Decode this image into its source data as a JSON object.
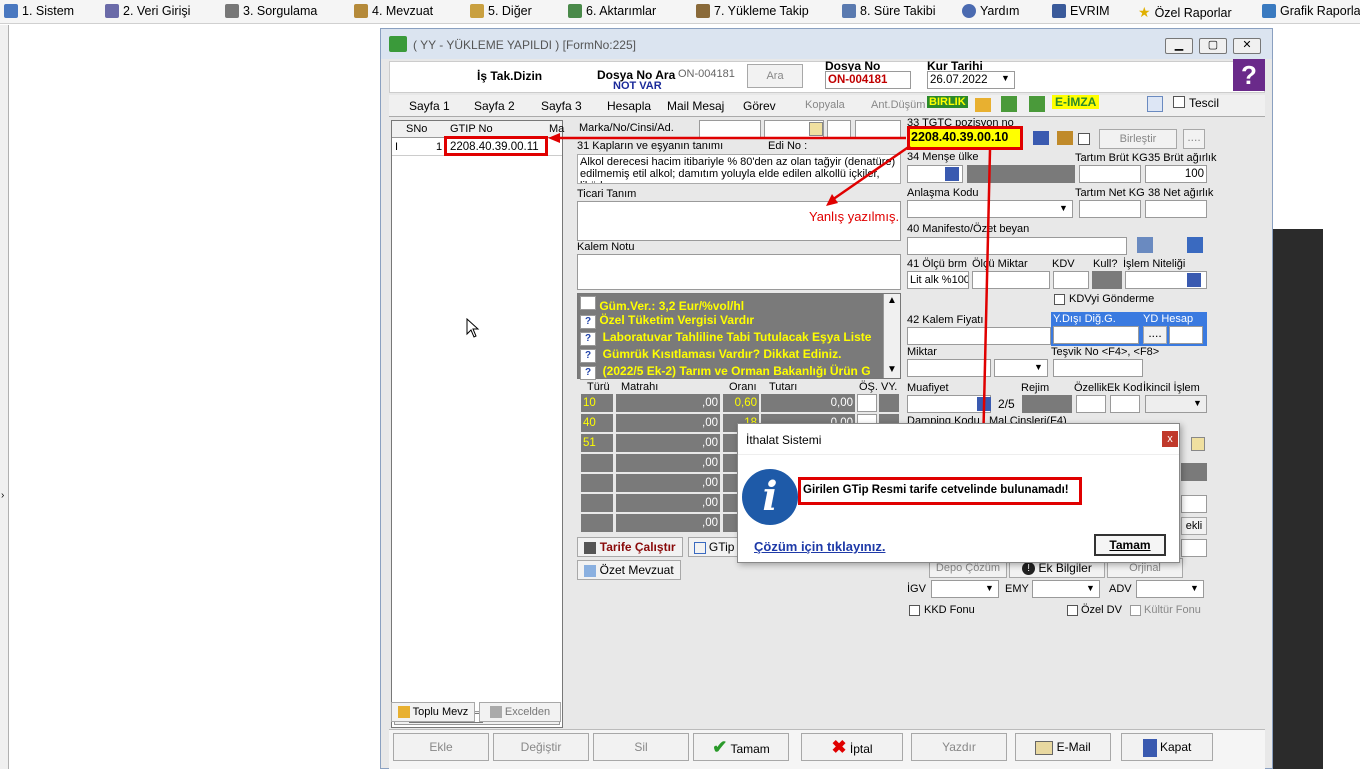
{
  "menu": [
    {
      "label": "1.  Sistem",
      "icon": "person-icon"
    },
    {
      "label": "2.  Veri Girişi",
      "icon": "edit-icon"
    },
    {
      "label": "3.  Sorgulama",
      "icon": "search-icon"
    },
    {
      "label": "4.  Mevzuat",
      "icon": "books-icon"
    },
    {
      "label": "5.  Diğer",
      "icon": "tools-icon"
    },
    {
      "label": "6.  Aktarımlar",
      "icon": "gear-icon"
    },
    {
      "label": "7.  Yükleme Takip",
      "icon": "pencil-icon"
    },
    {
      "label": "8. Süre Takibi",
      "icon": "calendar-icon"
    },
    {
      "label": "Yardım",
      "icon": "help-icon"
    },
    {
      "label": "EVRIM",
      "icon": "evrim-icon"
    },
    {
      "label": "Özel Raporlar",
      "icon": "star-icon"
    },
    {
      "label": "Grafik Raporlar",
      "icon": "chart-icon"
    }
  ],
  "window": {
    "title": "( YY  - YÜKLEME YAPILDI ) [FormNo:225]"
  },
  "header": {
    "is_takip": "İş Tak.Dizin",
    "dosya_no_ara": "Dosya No Ara",
    "dosya_no_ara_value": "ON-004181",
    "not_var": "NOT VAR",
    "ara": "Ara",
    "dosya_no_label": "Dosya No",
    "dosya_no_value": "ON-004181",
    "kur_tarihi_label": "Kur Tarihi",
    "kur_tarihi_value": "26.07.2022"
  },
  "tabs": [
    "Sayfa 1",
    "Sayfa 2",
    "Sayfa 3",
    "Hesapla",
    "Mail Mesaj",
    "Görev",
    "Kopyala",
    "Ant.Düşüm"
  ],
  "toolbar": {
    "birlik": "BIRLIK",
    "eimza": "E-İMZA",
    "tescil": "Tescil"
  },
  "grid": {
    "headers": [
      "SNo",
      "GTIP No",
      "Ma"
    ],
    "row": {
      "marker": "I",
      "sno": "1",
      "gtip": "2208.40.39.00.11"
    }
  },
  "item": {
    "marka_label": "Marka/No/Cinsi/Ad.",
    "kap_label": "31 Kapların ve eşyanın tanımı",
    "edi_label": "Edi No :",
    "description": "Alkol derecesi hacim itibariyle % 80'den az olan tağyir (denatüre) edilmemiş etil alkol; damıtım yoluyla elde edilen alkollü içkiler, likörler",
    "ticari_label": "Ticari Tanım",
    "kalem_notu_label": "Kalem Notu",
    "annotation": "Yanlış yazılmış.",
    "warnings": [
      "Güm.Ver.: 3,2 Eur/%vol/hl",
      "Özel Tüketim Vergisi Vardır",
      "Laboratuvar Tahliline Tabi Tutulacak Eşya Liste",
      "Gümrük Kısıtlaması Vardır? Dikkat Ediniz.",
      "(2022/5 Ek-2) Tarım ve Orman Bakanlığı Ürün G"
    ]
  },
  "tax": {
    "headers": [
      "Türü",
      "Matrahı",
      "Oranı",
      "Tutarı",
      "ÖŞ.",
      "VY."
    ],
    "rows": [
      [
        "10",
        ",00",
        "0,60",
        "0,00"
      ],
      [
        "40",
        ",00",
        "18",
        "0,00"
      ],
      [
        "51",
        ",00",
        ",0",
        ""
      ],
      [
        "",
        ",00",
        "",
        ""
      ],
      [
        "",
        ",00",
        "",
        ""
      ],
      [
        "",
        ",00",
        "",
        ""
      ],
      [
        "",
        ",00",
        "",
        ""
      ]
    ]
  },
  "buttons": {
    "tarife": "Tarife Çalıştır",
    "gtip": "GTip",
    "ozet": "Özet Mevzuat",
    "toplu": "Toplu Mevz",
    "excel": "Excelden"
  },
  "right": {
    "gtip_label": "33 TGTC pozisyon no",
    "gtip_value": "2208.40.39.00.10",
    "birlestir": "Birleştir",
    "mense": "34 Menşe ülke",
    "tartim_brut": "Tartım Brüt KG",
    "brut": "35 Brüt ağırlık",
    "brut_value": "100",
    "anlasma": "Anlaşma Kodu",
    "tartim_net": "Tartım Net KG",
    "net": "38 Net ağırlık",
    "manifesto": "40 Manifesto/Özet beyan",
    "olcu": "41 Ölçü brm",
    "olcu_miktar": "Ölçü Miktar",
    "kdv": "KDV",
    "kull": "Kull?",
    "islem": "İşlem Niteliği",
    "olcu_value": "Lit alk %100",
    "kdv_gonderme": "KDVyi Gönderme",
    "kalem_fiyati": "42 Kalem Fiyatı",
    "ydisi": "Y.Dışı Diğ.G.",
    "yd_hesap": "YD Hesap",
    "miktar": "Miktar",
    "tesvik": "Teşvik No <F4>, <F8>",
    "muafiyet": "Muafiyet",
    "rejim": "Rejim",
    "ozellik": "Özellik",
    "ek_kod": "Ek Kod",
    "ikincil": "İkincil İşlem",
    "rejim_value": "2/5",
    "damping": "Damping Kodu",
    "mal": "Mal Cinsleri(F4)",
    "ekli": "ekli",
    "depo": "Depo Çözüm",
    "ek_bilgiler": "Ek Bilgiler",
    "orjinal": "Orjinal",
    "igv": "İGV",
    "emy": "EMY",
    "adv": "ADV",
    "kkd": "KKD Fonu",
    "ozel_dv": "Özel DV",
    "kultur": "Kültür Fonu"
  },
  "bottom": {
    "ekle": "Ekle",
    "degistir": "Değiştir",
    "sil": "Sil",
    "tamam": "Tamam",
    "iptal": "İptal",
    "yazdir": "Yazdır",
    "email": "E-Mail",
    "kapat": "Kapat"
  },
  "dialog": {
    "title": "İthalat Sistemi",
    "message": "Girilen GTip Resmi tarife cetvelinde bulunamadı!",
    "link": "Çözüm için tıklayınız.",
    "ok": "Tamam"
  },
  "colors": {
    "red": "#e00000",
    "yellow": "#ffff00",
    "gray": "#7a7a7a"
  }
}
